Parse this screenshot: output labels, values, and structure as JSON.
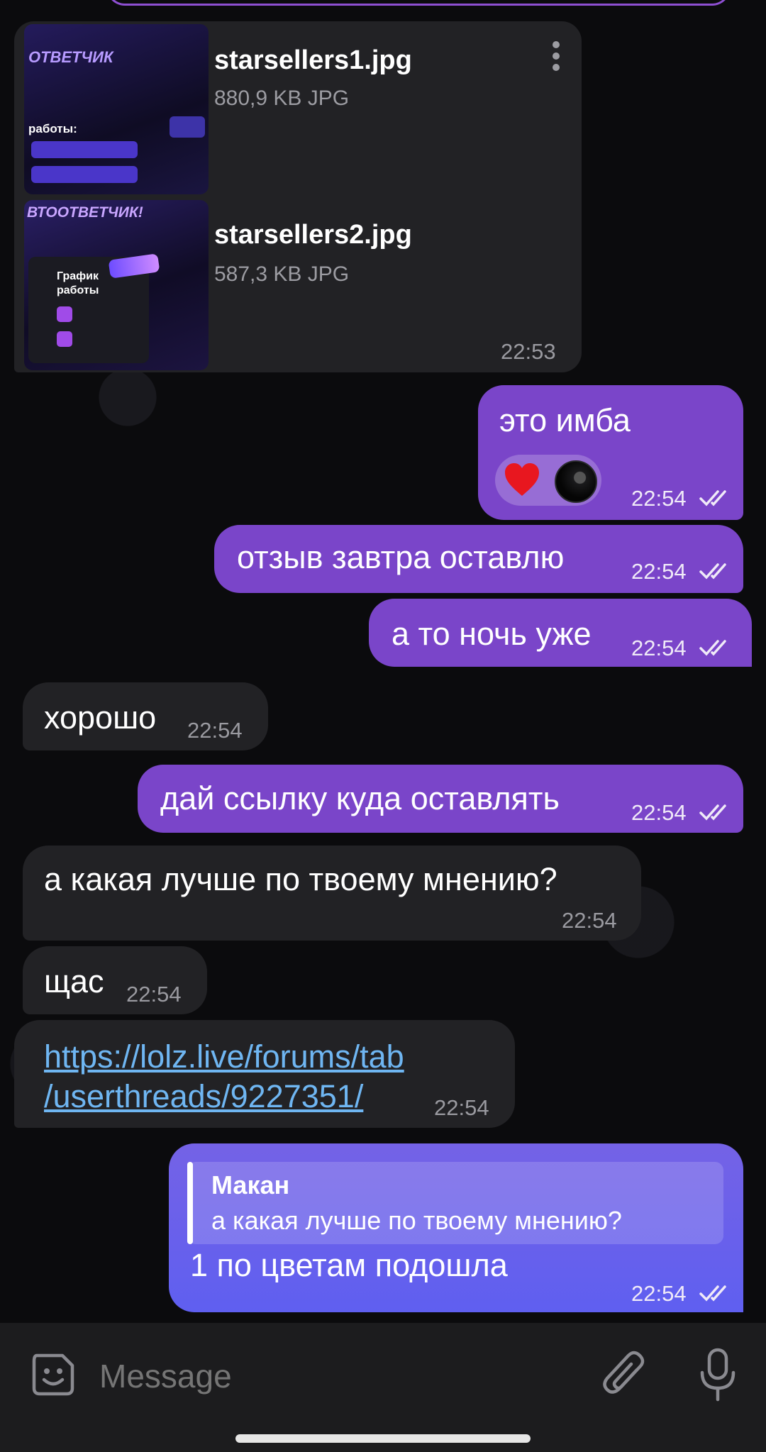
{
  "colors": {
    "background": "#0b0b0d",
    "incoming_bubble": "#222225",
    "outgoing_bubble": "#7a45c9",
    "outgoing_reply_bubble": "#6a60e8",
    "link": "#6fb6f2",
    "composer": "#1c1c1e"
  },
  "file_message": {
    "files": [
      {
        "name": "starsellers1.jpg",
        "meta": "880,9 KB JPG",
        "thumb_title": "ОТВЕТЧИК",
        "thumb_sub": "работы:"
      },
      {
        "name": "starsellers2.jpg",
        "meta": "587,3 KB JPG",
        "thumb_title": "ВТООТВЕТЧИК!",
        "thumb_sub": "График работы"
      }
    ],
    "time": "22:53",
    "menu_icon": "more-vertical-icon"
  },
  "messages": [
    {
      "text": "это имба",
      "time": "22:54",
      "reactions": [
        "red-heart",
        "avatar"
      ]
    },
    {
      "text": "отзыв завтра оставлю",
      "time": "22:54"
    },
    {
      "text": "а то ночь уже",
      "time": "22:54"
    },
    {
      "text": "хорошо",
      "time": "22:54"
    },
    {
      "text": "дай ссылку куда оставлять",
      "time": "22:54"
    },
    {
      "text": "а какая лучше по твоему мнению?",
      "time": "22:54"
    },
    {
      "text": "щас",
      "time": "22:54"
    },
    {
      "link_line1": "https://lolz.live/forums/tab",
      "link_line2": "/userthreads/9227351/",
      "time": "22:54"
    },
    {
      "reply_author": "Макан",
      "reply_text": "а какая лучше по твоему мнению?",
      "text": "1 по цветам подошла",
      "time": "22:54"
    }
  ],
  "composer": {
    "placeholder": "Message",
    "emoji_icon": "sticker-emoji-icon",
    "attach_icon": "paperclip-icon",
    "mic_icon": "microphone-icon"
  }
}
